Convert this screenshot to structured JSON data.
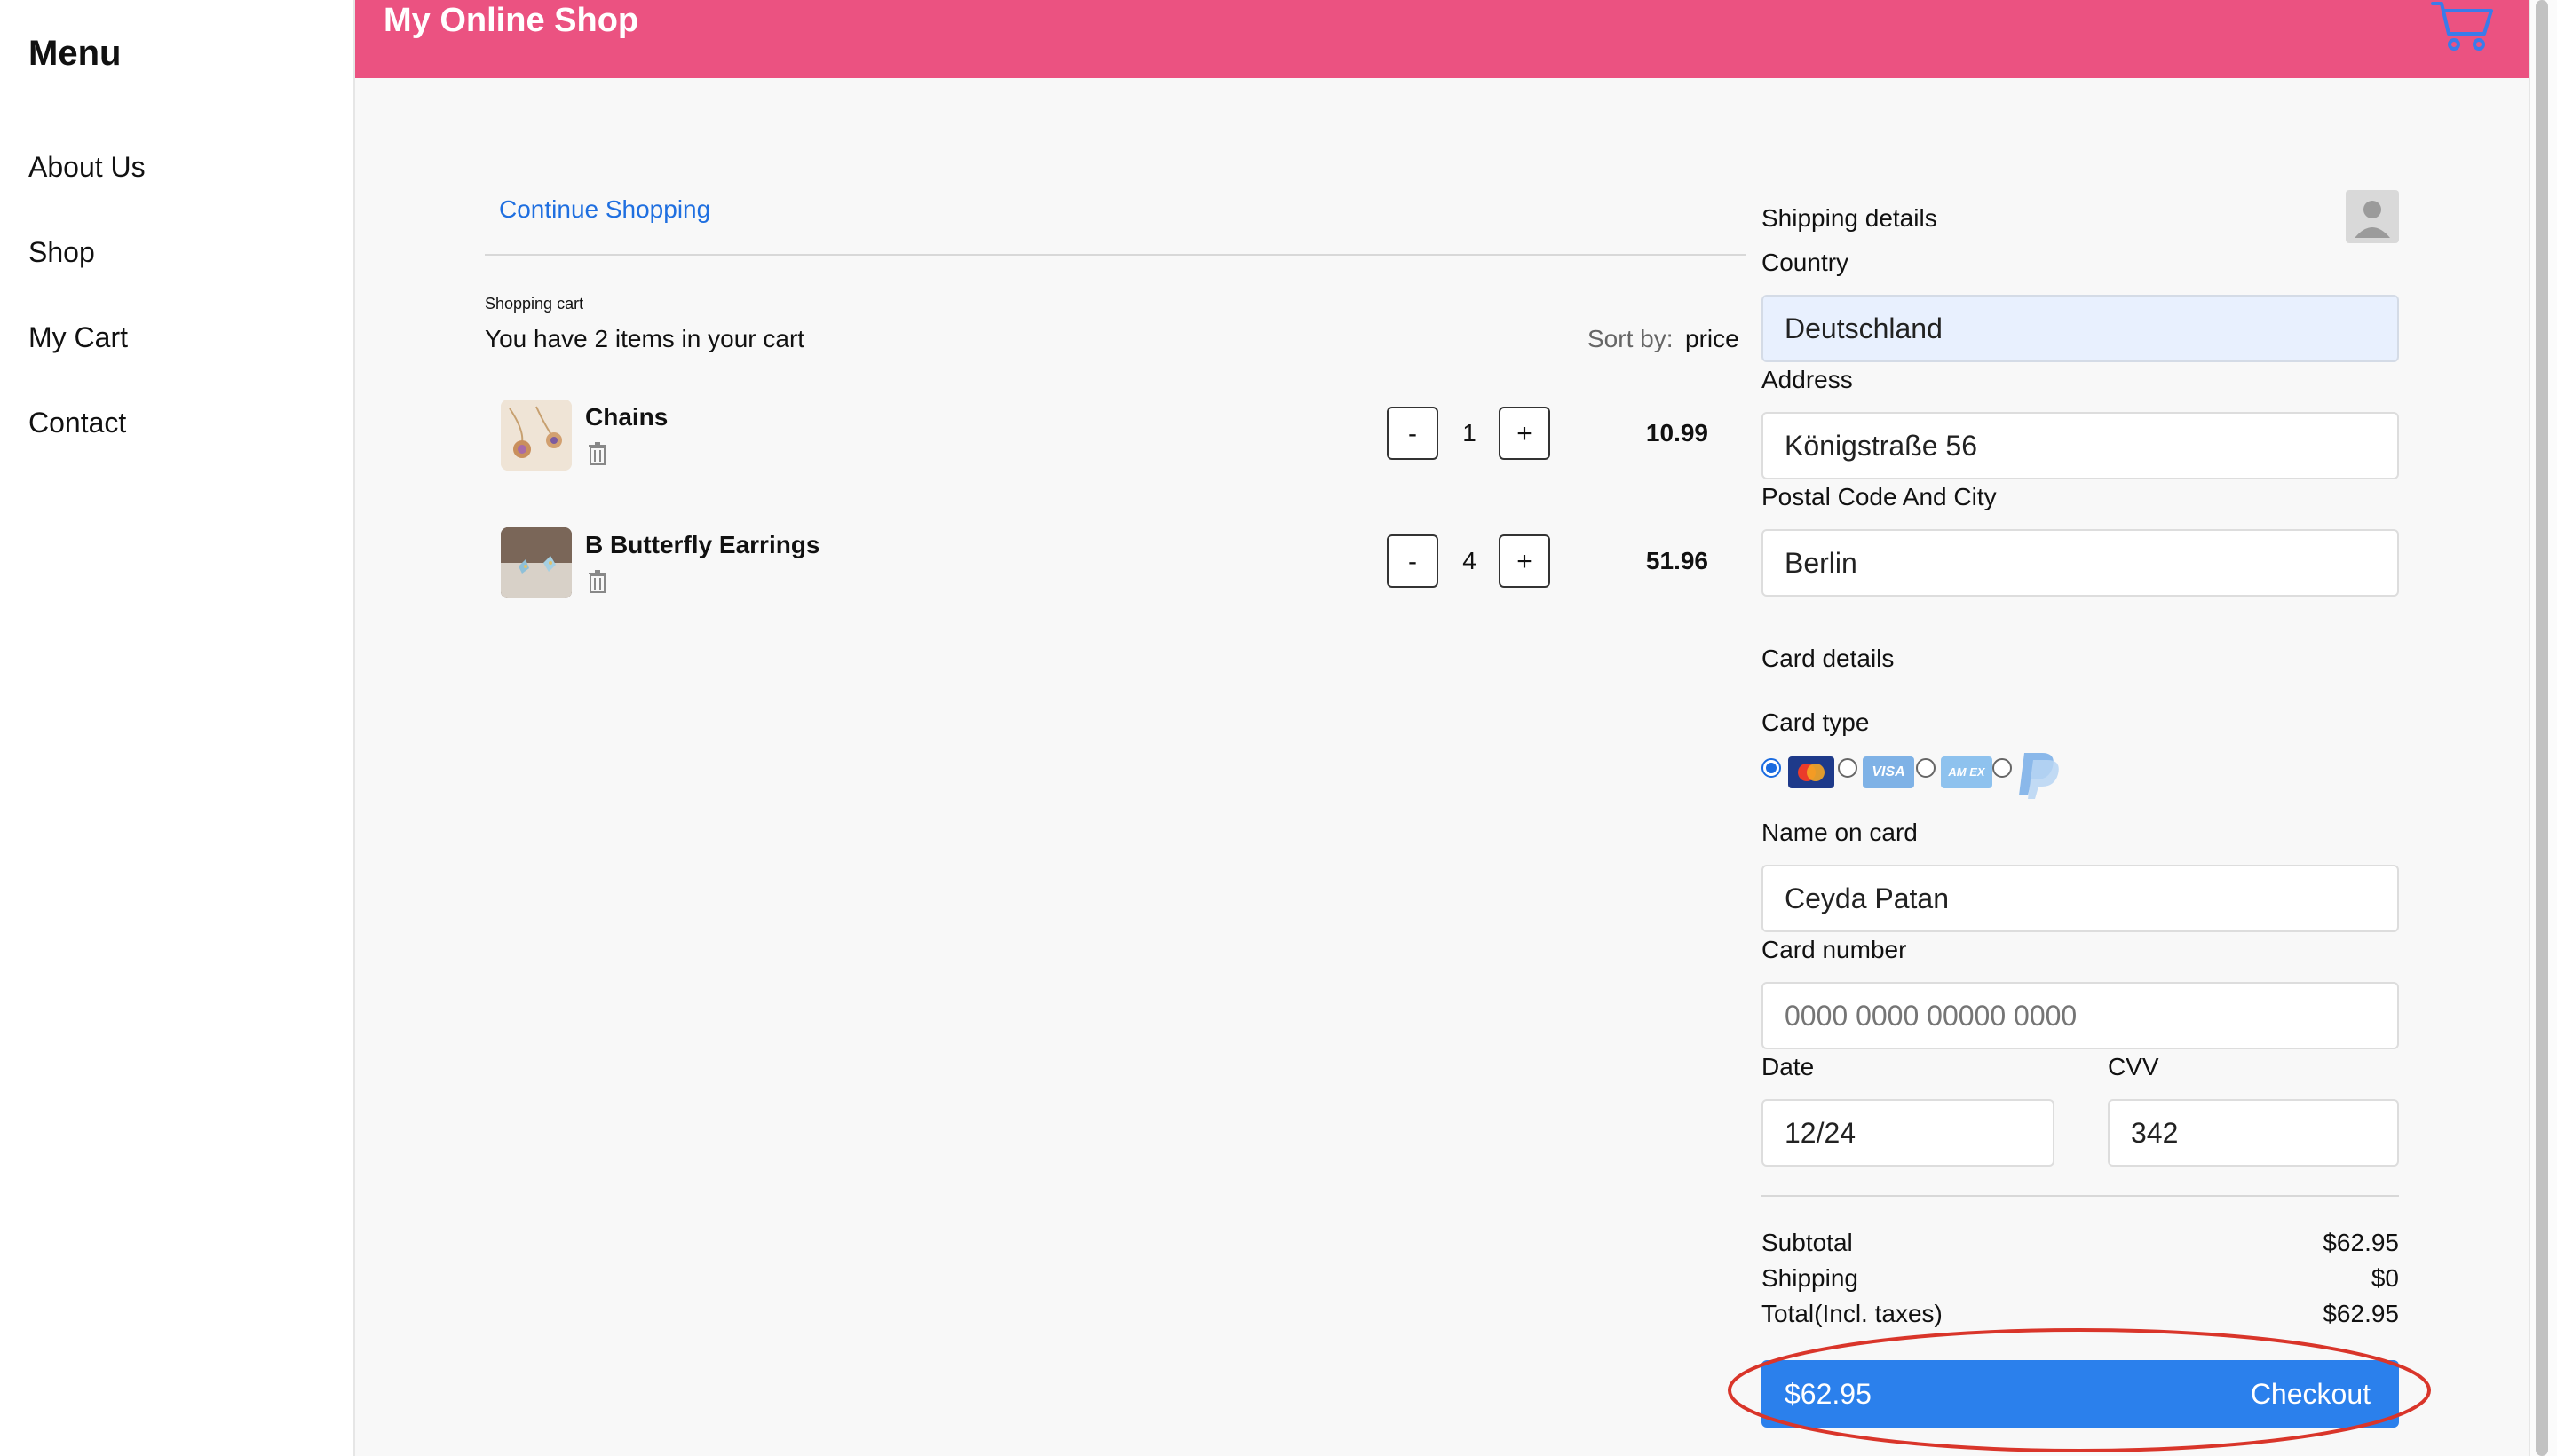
{
  "sidebar": {
    "title": "Menu",
    "items": [
      {
        "label": "About Us"
      },
      {
        "label": "Shop"
      },
      {
        "label": "My Cart"
      },
      {
        "label": "Contact"
      }
    ]
  },
  "header": {
    "title": "My Online Shop",
    "cart_icon": "shopping-cart-icon"
  },
  "cart": {
    "continue_link": "Continue Shopping",
    "section_label": "Shopping cart",
    "summary_text": "You have 2 items in your cart",
    "sort_label": "Sort by:",
    "sort_value": "price",
    "items": [
      {
        "name": "Chains",
        "qty": "1",
        "price": "10.99",
        "minus": "-",
        "plus": "+"
      },
      {
        "name": "B Butterfly Earrings",
        "qty": "4",
        "price": "51.96",
        "minus": "-",
        "plus": "+"
      }
    ]
  },
  "shipping": {
    "title": "Shipping details",
    "country_label": "Country",
    "country_value": "Deutschland",
    "address_label": "Address",
    "address_value": "Königstraße 56",
    "postal_label": "Postal Code And City",
    "postal_value": "Berlin"
  },
  "card": {
    "title": "Card details",
    "type_label": "Card type",
    "types": [
      "mastercard",
      "visa",
      "amex",
      "paypal"
    ],
    "visa_text": "VISA",
    "amex_text": "AM EX",
    "name_label": "Name on card",
    "name_value": "Ceyda Patan",
    "number_label": "Card number",
    "number_placeholder": "0000 0000 00000 0000",
    "date_label": "Date",
    "date_value": "12/24",
    "cvv_label": "CVV",
    "cvv_value": "342"
  },
  "summary": {
    "subtotal_label": "Subtotal",
    "subtotal_value": "$62.95",
    "shipping_label": "Shipping",
    "shipping_value": "$0",
    "total_label": "Total(Incl. taxes)",
    "total_value": "$62.95"
  },
  "checkout": {
    "amount": "$62.95",
    "label": "Checkout"
  },
  "colors": {
    "header": "#eb5281",
    "accent": "#2b80ec",
    "link": "#1f6fe0",
    "highlight_ring": "#d9352a"
  }
}
